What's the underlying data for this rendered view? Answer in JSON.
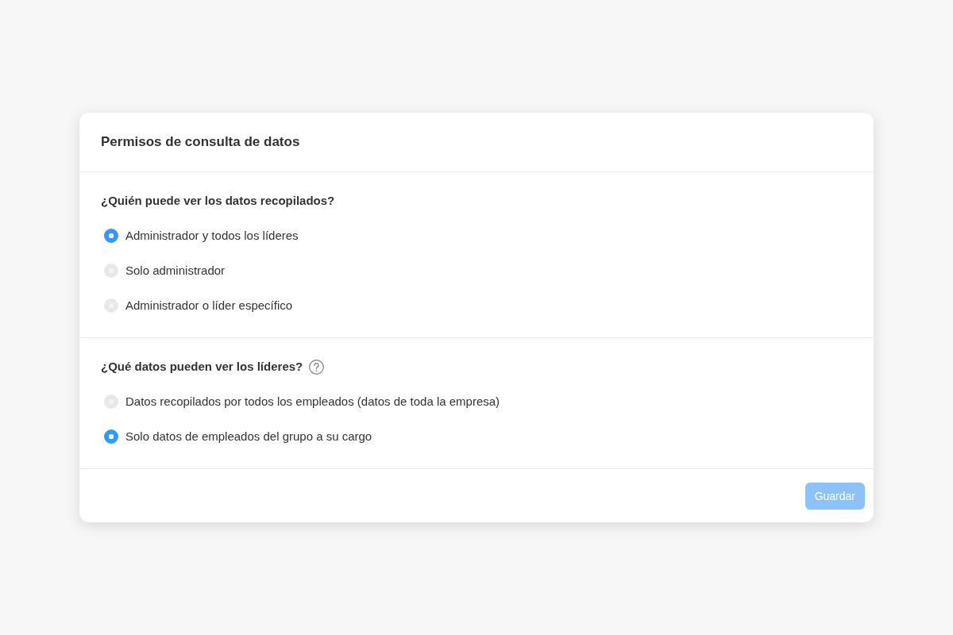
{
  "dialog": {
    "title": "Permisos de consulta de datos"
  },
  "sections": [
    {
      "question": "¿Quién puede ver los datos recopilados?",
      "help_icon": false,
      "options": [
        {
          "label": "Administrador y todos los líderes",
          "selected": true
        },
        {
          "label": "Solo administrador",
          "selected": false
        },
        {
          "label": "Administrador o líder específico",
          "selected": false
        }
      ]
    },
    {
      "question": "¿Qué datos pueden ver los líderes?",
      "help_icon": true,
      "options": [
        {
          "label": "Datos recopilados por todos los empleados (datos de toda la empresa)",
          "selected": false
        },
        {
          "label": "Solo datos de empleados del grupo a su cargo",
          "selected": true
        }
      ]
    }
  ],
  "footer": {
    "save_button": {
      "label": "Guardar",
      "disabled": true
    }
  }
}
